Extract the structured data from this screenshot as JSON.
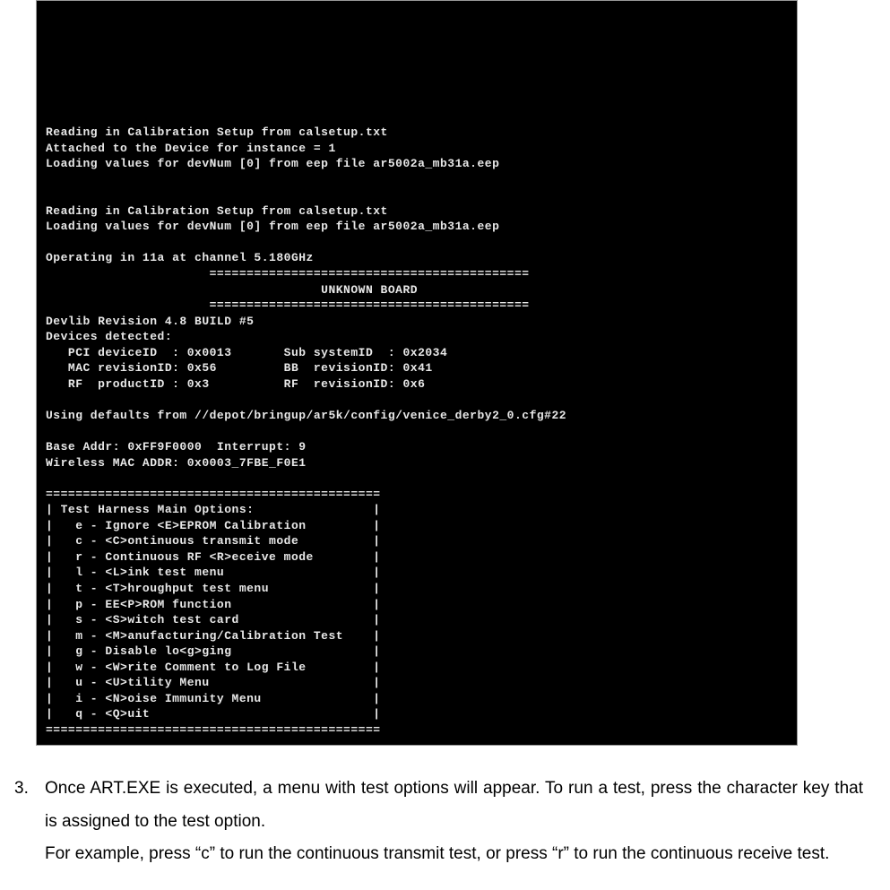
{
  "terminal": {
    "block1": [
      "Reading in Calibration Setup from calsetup.txt",
      "Attached to the Device for instance = 1",
      "Loading values for devNum [0] from eep file ar5002a_mb31a.eep"
    ],
    "block2": [
      "Reading in Calibration Setup from calsetup.txt",
      "Loading values for devNum [0] from eep file ar5002a_mb31a.eep"
    ],
    "operating_line": "Operating in 11a at channel 5.180GHz",
    "sep_line": "                      ===========================================",
    "board_line": "                                     UNKNOWN BOARD",
    "devlib_line": "Devlib Revision 4.8 BUILD #5",
    "devices_header": "Devices detected:",
    "dev_row1": "   PCI deviceID  : 0x0013       Sub systemID  : 0x2034",
    "dev_row2": "   MAC revisionID: 0x56         BB  revisionID: 0x41",
    "dev_row3": "   RF  productID : 0x3          RF  revisionID: 0x6",
    "defaults_line": "Using defaults from //depot/bringup/ar5k/config/venice_derby2_0.cfg#22",
    "base_addr_line": "Base Addr: 0xFF9F0000  Interrupt: 9",
    "mac_line": "Wireless MAC ADDR: 0x0003_7FBE_F0E1",
    "menu_sep": "=============================================",
    "menu_title": "| Test Harness Main Options:                |",
    "menu_items": [
      "|   e - Ignore <E>EPROM Calibration         |",
      "|   c - <C>ontinuous transmit mode          |",
      "|   r - Continuous RF <R>eceive mode        |",
      "|   l - <L>ink test menu                    |",
      "|   t - <T>hroughput test menu              |",
      "|   p - EE<P>ROM function                   |",
      "|   s - <S>witch test card                  |",
      "|   m - <M>anufacturing/Calibration Test    |",
      "|   g - Disable lo<g>ging                   |",
      "|   w - <W>rite Comment to Log File         |",
      "|   u - <U>tility Menu                      |",
      "|   i - <N>oise Immunity Menu               |",
      "|   q - <Q>uit                              |"
    ]
  },
  "instruction": {
    "number": "3.",
    "line1": "Once ART.EXE is executed, a menu with test options will appear. To run a test, press the character key that is assigned to the test option.",
    "line2": "For example, press “c” to run the continuous transmit test, or press “r” to run the continuous receive test."
  }
}
